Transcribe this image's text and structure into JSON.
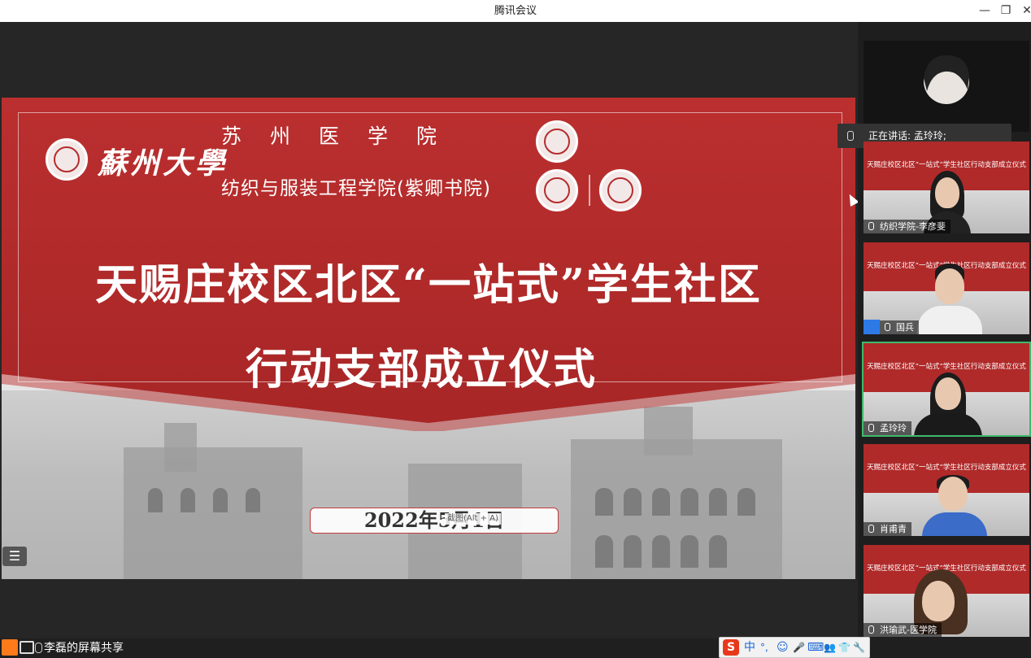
{
  "window": {
    "title": "腾讯会议",
    "minimize": "—",
    "restore": "❐",
    "close": "✕"
  },
  "slide": {
    "university": "蘇州大學",
    "school1": "苏州医学院",
    "school2": "纺织与服装工程学院(紫卿书院)",
    "heading1": "天赐庄校区北区“一站式”学生社区",
    "heading2": "行动支部成立仪式",
    "date": "2022年5月1日",
    "tooltip": "截图(Alt + A)"
  },
  "menu_icon": "☰",
  "speaking": {
    "label": "正在讲话: 孟玲玲;"
  },
  "participants": [
    {
      "name": "",
      "icon": "person-avatar-icon"
    },
    {
      "name": "纺织学院-李彦斐",
      "slide_text": "天赐庄校区北区“一站式”学生社区行动支部成立仪式"
    },
    {
      "name": "国兵",
      "slide_text": "天赐庄校区北区“一站式”学生社区行动支部成立仪式"
    },
    {
      "name": "孟玲玲",
      "slide_text": "天赐庄校区北区“一站式”学生社区行动支部成立仪式"
    },
    {
      "name": "肖甫青",
      "slide_text": "天赐庄校区北区“一站式”学生社区行动支部成立仪式"
    },
    {
      "name": "洪瑜武-医学院",
      "slide_text": "天赐庄校区北区“一站式”学生社区行动支部成立仪式"
    }
  ],
  "share": {
    "label": "李磊的屏幕共享"
  },
  "ime": {
    "logo": "S",
    "mode": "中",
    "punct": "°,",
    "items": [
      "☺",
      "🎤",
      "⌨",
      "👥",
      "👕",
      "🔧"
    ]
  },
  "colors": {
    "accent_red": "#b52b2b",
    "speaking_green": "#3fb96b",
    "ime_blue": "#1a66d6"
  }
}
